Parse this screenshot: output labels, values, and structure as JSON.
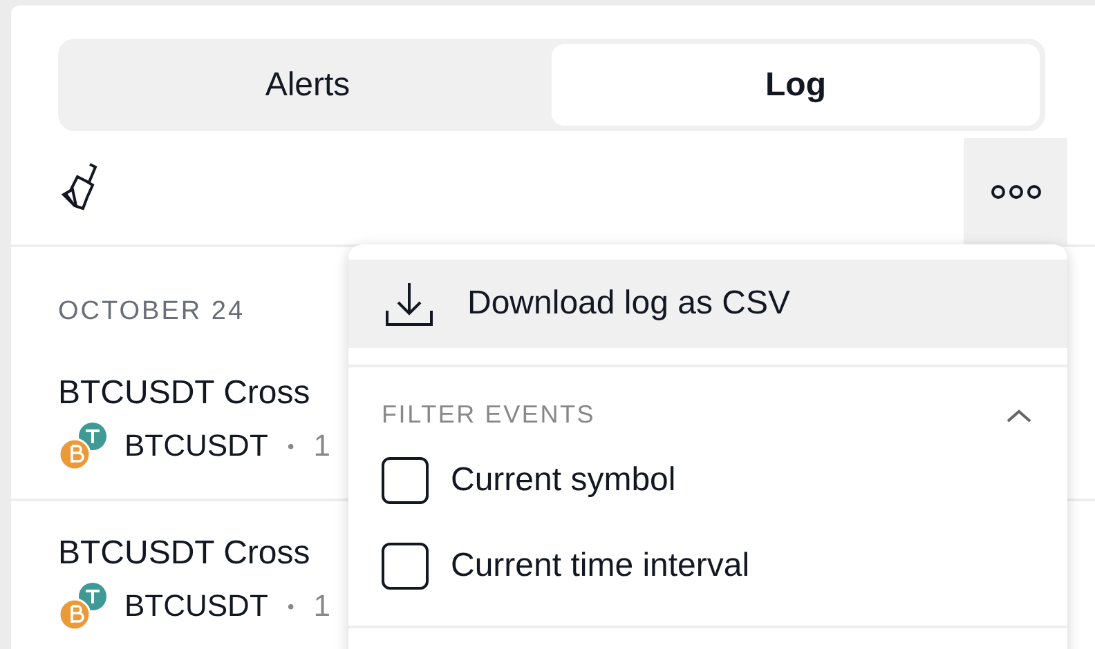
{
  "tabs": [
    {
      "label": "Alerts",
      "selected": false
    },
    {
      "label": "Log",
      "selected": true
    }
  ],
  "log": {
    "date": "OCTOBER 24",
    "entries": [
      {
        "title": "BTCUSDT Cross",
        "symbol": "BTCUSDT",
        "separator": "•",
        "time": "1"
      },
      {
        "title": "BTCUSDT Cross",
        "symbol": "BTCUSDT",
        "separator": "•",
        "time": "1"
      }
    ]
  },
  "menu": {
    "download": {
      "label": "Download log as CSV",
      "highlighted": true
    },
    "filter_heading": "FILTER EVENTS",
    "expanded": true,
    "filters": [
      {
        "label": "Current symbol",
        "checked": false
      },
      {
        "label": "Current time interval",
        "checked": false
      }
    ]
  }
}
